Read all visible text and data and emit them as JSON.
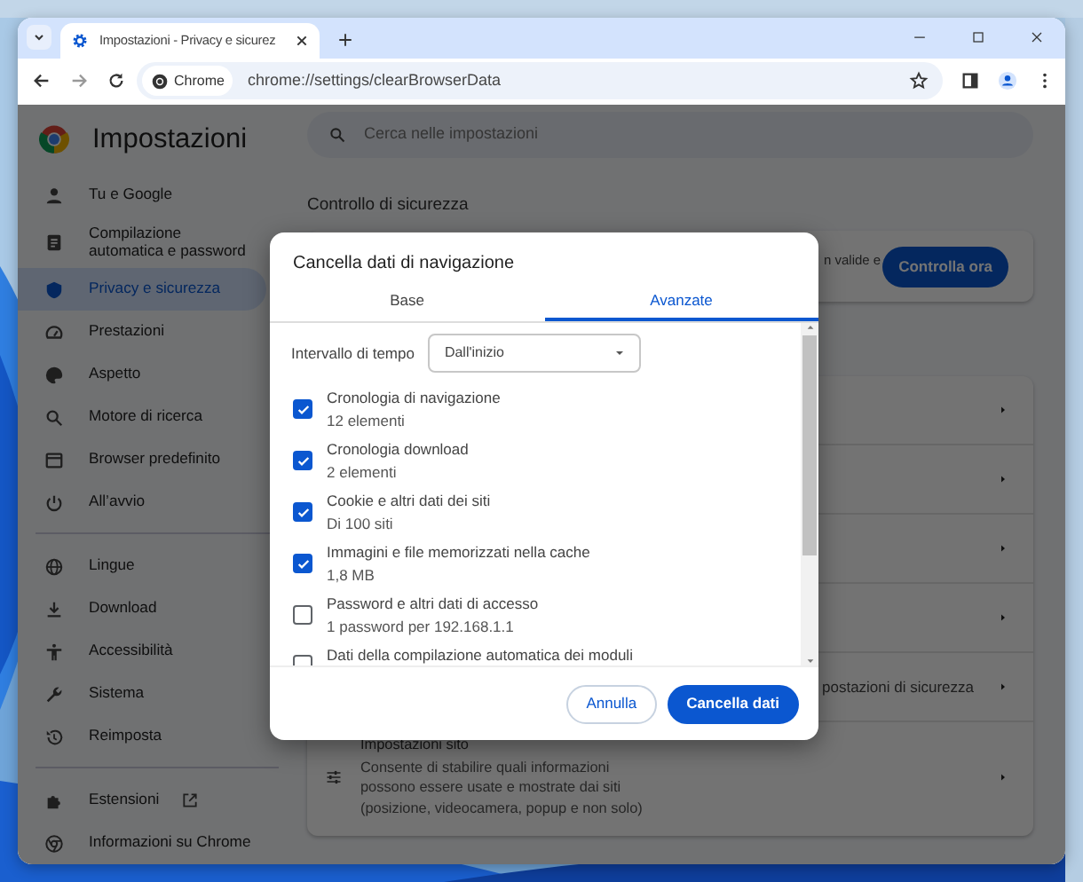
{
  "tab_strip": {
    "tabs": [
      {
        "title": "Impostazioni - Privacy e sicurez",
        "selected": true
      }
    ]
  },
  "toolbar": {
    "chip": "Chrome",
    "url": "chrome://settings/clearBrowserData"
  },
  "sidebar": {
    "title": "Impostazioni",
    "groups": [
      [
        {
          "label": "Tu e Google",
          "selected": false
        },
        {
          "label": "Compilazione automatica e password",
          "selected": false
        },
        {
          "label": "Privacy e sicurezza",
          "selected": true
        },
        {
          "label": "Prestazioni",
          "selected": false
        },
        {
          "label": "Aspetto",
          "selected": false
        },
        {
          "label": "Motore di ricerca",
          "selected": false
        },
        {
          "label": "Browser predefinito",
          "selected": false
        },
        {
          "label": "All’avvio",
          "selected": false
        }
      ],
      [
        {
          "label": "Lingue",
          "selected": false
        },
        {
          "label": "Download",
          "selected": false
        },
        {
          "label": "Accessibilità",
          "selected": false
        },
        {
          "label": "Sistema",
          "selected": false
        },
        {
          "label": "Reimposta",
          "selected": false
        }
      ],
      [
        {
          "label": "Estensioni",
          "selected": false
        },
        {
          "label": "Informazioni su Chrome",
          "selected": false
        }
      ]
    ]
  },
  "search": {
    "placeholder": "Cerca nelle impostazioni"
  },
  "main": {
    "section_title": "Controllo di sicurezza",
    "safety_card": {
      "text": "n valide e",
      "button": "Controlla ora"
    },
    "privacy_rows": [
      {
        "text": ""
      },
      {
        "text": ""
      },
      {
        "text": ""
      },
      {
        "text": ""
      },
      {
        "text": "postazioni di sicurezza"
      }
    ],
    "site_settings": {
      "title": "Impostazioni sito",
      "description": "Consente di stabilire quali informazioni possono essere usate e mostrate dai siti (posizione, videocamera, popup e non solo)"
    }
  },
  "dialog": {
    "title": "Cancella dati di navigazione",
    "tabs": [
      {
        "label": "Base",
        "selected": false
      },
      {
        "label": "Avanzate",
        "selected": true
      }
    ],
    "time_range": {
      "label": "Intervallo di tempo",
      "value": "Dall'inizio"
    },
    "items": [
      {
        "label": "Cronologia di navigazione",
        "detail": "12 elementi",
        "checked": true
      },
      {
        "label": "Cronologia download",
        "detail": "2 elementi",
        "checked": true
      },
      {
        "label": "Cookie e altri dati dei siti",
        "detail": "Di 100 siti",
        "checked": true
      },
      {
        "label": "Immagini e file memorizzati nella cache",
        "detail": "1,8 MB",
        "checked": true
      },
      {
        "label": "Password e altri dati di accesso",
        "detail": "1 password per 192.168.1.1",
        "checked": false
      },
      {
        "label": "Dati della compilazione automatica dei moduli",
        "checked": false
      }
    ],
    "buttons": [
      {
        "label": "Annulla",
        "kind": "secondary"
      },
      {
        "label": "Cancella dati",
        "kind": "primary"
      }
    ]
  }
}
